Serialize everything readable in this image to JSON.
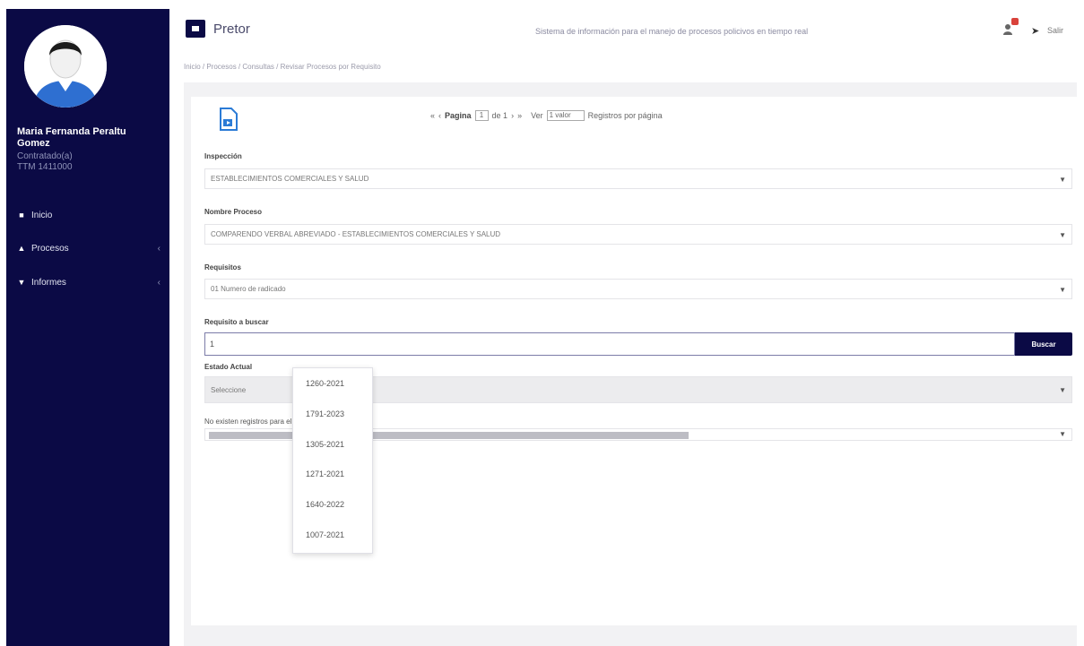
{
  "sidebar": {
    "user_name": "Maria Fernanda Peraltu Gomez",
    "user_role_line1": "Contratado(a)",
    "user_role_line2": "TTM 1411000",
    "items": [
      {
        "label": "Inicio",
        "icon": "grid-icon"
      },
      {
        "label": "Procesos",
        "icon": "sitemap-icon"
      },
      {
        "label": "Informes",
        "icon": "chart-icon"
      }
    ]
  },
  "header": {
    "title": "Pretor",
    "tagline": "Sistema de información para el manejo de procesos policivos en tiempo real",
    "exit_label": "Salir"
  },
  "breadcrumb": "Inicio / Procesos / Consultas / Revisar Procesos por Requisito",
  "pager": {
    "page_label": "Pagina",
    "page_value": "1",
    "of_label": "de 1",
    "show_label": "Ver",
    "per_page_value": "1 valor",
    "per_page_label": "Registros por página"
  },
  "form": {
    "inspeccion_label": "Inspección",
    "inspeccion_value": "ESTABLECIMIENTOS COMERCIALES Y SALUD",
    "proceso_label": "Nombre Proceso",
    "proceso_value": "COMPARENDO VERBAL ABREVIADO - ESTABLECIMIENTOS COMERCIALES Y SALUD",
    "requisitos_label": "Requisitos",
    "requisitos_value": "01 Numero de radicado",
    "buscar_label": "Requisito a buscar",
    "buscar_value": "1",
    "buscar_button": "Buscar",
    "estado_label": "Estado Actual",
    "estado_value": "Seleccione",
    "no_results": "No existen registros para el filtro activo"
  },
  "dropdown": {
    "options": [
      "1260-2021",
      "1791-2023",
      "1305-2021",
      "1271-2021",
      "1640-2022",
      "1007-2021"
    ]
  }
}
